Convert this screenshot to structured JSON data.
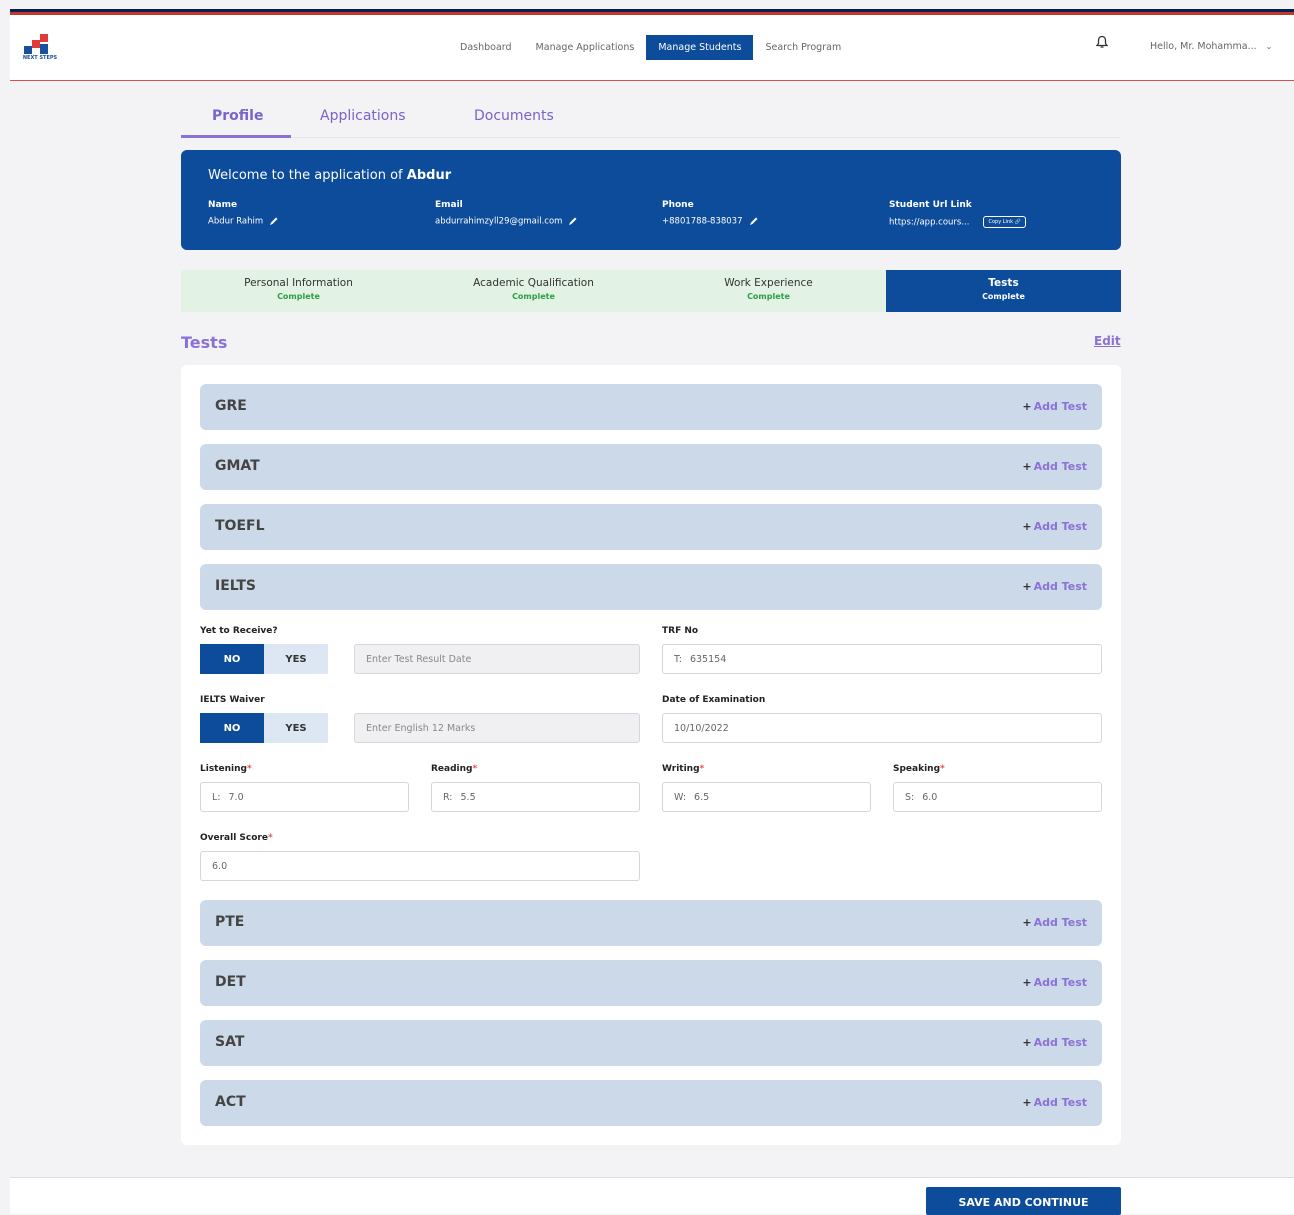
{
  "header": {
    "logo_text": "NEXT STEPS",
    "nav": [
      "Dashboard",
      "Manage Applications",
      "Manage Students",
      "Search Program"
    ],
    "greeting": "Hello, Mr. Mohamma..."
  },
  "tabs": [
    "Profile",
    "Applications",
    "Documents"
  ],
  "welcome": {
    "prefix": "Welcome to the application of ",
    "student": "Abdur",
    "name_label": "Name",
    "name": "Abdur Rahim",
    "email_label": "Email",
    "email": "abdurrahimzyll29@gmail.com",
    "phone_label": "Phone",
    "phone": "+8801788-838037",
    "url_label": "Student Url Link",
    "url": "https://app.cours...",
    "copy_label": "Copy Link"
  },
  "steps": [
    {
      "name": "Personal Information",
      "status": "Complete"
    },
    {
      "name": "Academic Qualification",
      "status": "Complete"
    },
    {
      "name": "Work Experience",
      "status": "Complete"
    },
    {
      "name": "Tests",
      "status": "Complete"
    }
  ],
  "section": {
    "title": "Tests",
    "edit": "Edit"
  },
  "add_test_label": "Add Test",
  "tests": [
    "GRE",
    "GMAT",
    "TOEFL",
    "IELTS",
    "PTE",
    "DET",
    "SAT",
    "ACT"
  ],
  "ielts": {
    "yet_label": "Yet to Receive?",
    "no": "NO",
    "yes": "YES",
    "result_date_placeholder": "Enter Test Result Date",
    "trf_label": "TRF No",
    "trf_prefix": "T:",
    "trf_value": "635154",
    "waiver_label": "IELTS Waiver",
    "english_placeholder": "Enter English 12 Marks",
    "exam_date_label": "Date of Examination",
    "exam_date": "10/10/2022",
    "listening_label": "Listening",
    "listening_prefix": "L:",
    "listening": "7.0",
    "reading_label": "Reading",
    "reading_prefix": "R:",
    "reading": "5.5",
    "writing_label": "Writing",
    "writing_prefix": "W:",
    "writing": "6.5",
    "speaking_label": "Speaking",
    "speaking_prefix": "S:",
    "speaking": "6.0",
    "overall_label": "Overall Score",
    "overall": "6.0",
    "required_mark": "*"
  },
  "save_button": "SAVE AND CONTINUE",
  "colors": {
    "primary": "#0d4b9b",
    "accent": "#8a72d6",
    "complete_green": "#2e9e44",
    "test_bar": "#ccd9e9"
  }
}
